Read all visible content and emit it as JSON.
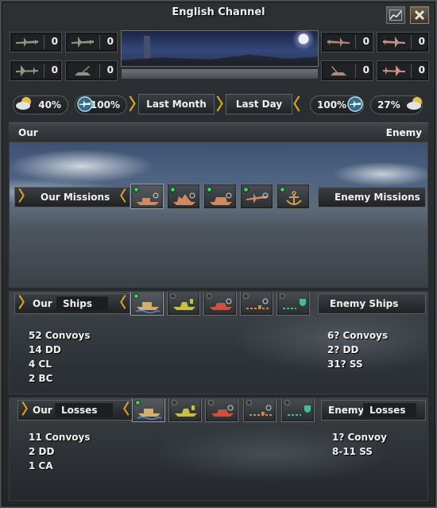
{
  "window": {
    "title": "English Channel"
  },
  "counters": {
    "our_top": [
      {
        "icon": "fighter-plane-icon",
        "count": "0"
      },
      {
        "icon": "naval-bomber-icon",
        "count": "0"
      }
    ],
    "our_bottom": [
      {
        "icon": "bomber-plane-icon",
        "count": "0"
      },
      {
        "icon": "anti-air-gun-icon",
        "count": "0"
      }
    ],
    "enemy_top": [
      {
        "icon": "enemy-fighter-plane-icon",
        "count": "0"
      },
      {
        "icon": "enemy-naval-bomber-icon",
        "count": "0"
      }
    ],
    "enemy_bottom": [
      {
        "icon": "enemy-anti-air-gun-icon",
        "count": "0"
      },
      {
        "icon": "enemy-bomber-plane-icon",
        "count": "0"
      }
    ]
  },
  "stats": {
    "our_weather": "40%",
    "our_air_superiority": "100%",
    "enemy_air_superiority": "100%",
    "enemy_weather": "27%"
  },
  "timeframe": {
    "last_month_prefix": "Last",
    "last_month_word": "Month",
    "last_day": "Last Day"
  },
  "sides": {
    "our": "Our",
    "enemy": "Enemy"
  },
  "missions": {
    "our_label": "Our Missions",
    "enemy_label": "Enemy Missions",
    "tabs": [
      {
        "icon": "convoy-raid-mission-icon"
      },
      {
        "icon": "patrol-mission-icon"
      },
      {
        "icon": "strike-force-mission-icon"
      },
      {
        "icon": "naval-air-mission-icon"
      },
      {
        "icon": "anchor-icon"
      }
    ]
  },
  "ships": {
    "our_prefix": "Our",
    "our_word": "Ships",
    "enemy_label": "Enemy Ships",
    "our_list": [
      "52 Convoys",
      "14 DD",
      "4 CL",
      "2 BC"
    ],
    "enemy_list": [
      "6? Convoys",
      "2? DD",
      "31? SS"
    ]
  },
  "losses": {
    "our_prefix": "Our",
    "our_word": "Losses",
    "enemy_prefix": "Enemy",
    "enemy_word": "Losses",
    "our_list": [
      "11 Convoys",
      "2 DD",
      "1 CA"
    ],
    "enemy_list": [
      "1? Convoy",
      "8-11 SS"
    ]
  },
  "colors": {
    "accent_chevron": "#e0a81c",
    "led_active": "#39d06a"
  }
}
